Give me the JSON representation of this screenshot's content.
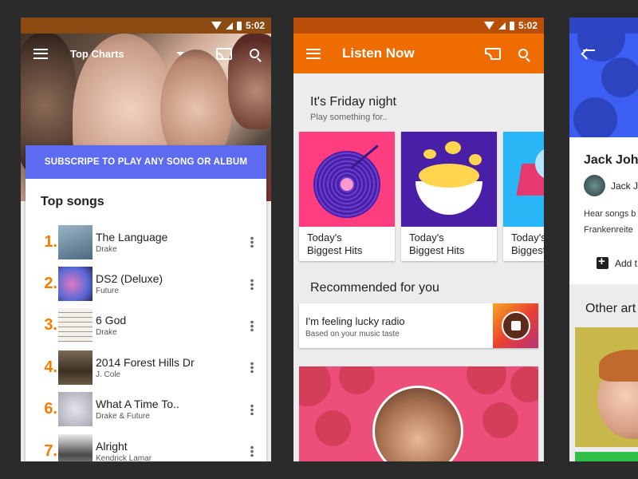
{
  "status": {
    "time": "5:02"
  },
  "top_charts": {
    "title": "Top Charts",
    "subscribe": "SUBSCRIPE TO PLAY ANY SONG OR ALBUM",
    "section": "Top songs",
    "songs": [
      {
        "rank": "1.",
        "title": "The Language",
        "artist": "Drake",
        "art": "#6f8fa6"
      },
      {
        "rank": "2.",
        "title": "DS2 (Deluxe)",
        "artist": "Future",
        "art": "#9a6fb8"
      },
      {
        "rank": "3.",
        "title": "6 God",
        "artist": "Drake",
        "art": "#f2efe8"
      },
      {
        "rank": "4.",
        "title": "2014 Forest Hills Dr",
        "artist": "J. Cole",
        "art": "#5a4a38"
      },
      {
        "rank": "6.",
        "title": "What A Time To..",
        "artist": "Drake & Future",
        "art": "#c9c9cf"
      },
      {
        "rank": "7.",
        "title": "Alright",
        "artist": "Kendrick Lamar",
        "art": "#7c7c7c"
      }
    ]
  },
  "listen_now": {
    "title": "Listen Now",
    "heading": "It's Friday night",
    "subheading": "Play something for..",
    "tiles": [
      {
        "caption_1": "Today's",
        "caption_2": "Biggest Hits",
        "bg": "#ff3d7f"
      },
      {
        "caption_1": "Today's",
        "caption_2": "Biggest Hits",
        "bg": "#4a1fa8"
      },
      {
        "caption_1": "Today's",
        "caption_2": "Biggest Hits",
        "bg": "#29b6f6"
      }
    ],
    "recommended": "Recommended for you",
    "lucky_title": "I'm feeling lucky radio",
    "lucky_sub": "Based on your music taste"
  },
  "artist": {
    "name": "Jack John",
    "avatar_label": "Jack J",
    "desc_1": "Hear songs b",
    "desc_2": "Frankenreite",
    "add": "Add t",
    "other": "Other art"
  }
}
